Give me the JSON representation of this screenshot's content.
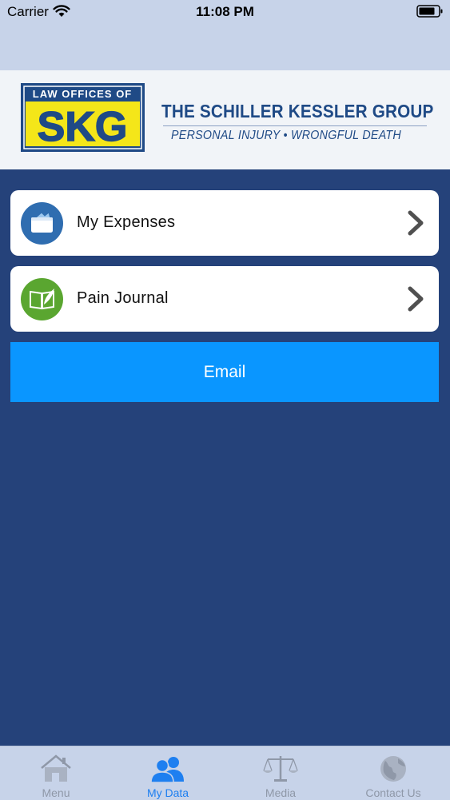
{
  "status_bar": {
    "carrier": "Carrier",
    "time": "11:08 PM"
  },
  "banner": {
    "logo_top": "LAW OFFICES OF",
    "logo_main": "SKG",
    "firm_name": "THE SCHILLER KESSLER GROUP",
    "tagline": "PERSONAL INJURY • WRONGFUL DEATH"
  },
  "menu": {
    "items": [
      {
        "label": "My Expenses",
        "icon": "wallet-icon"
      },
      {
        "label": "Pain Journal",
        "icon": "journal-icon"
      }
    ]
  },
  "email_button": {
    "label": "Email"
  },
  "tabs": [
    {
      "label": "Menu",
      "icon": "home-icon",
      "active": false
    },
    {
      "label": "My Data",
      "icon": "users-icon",
      "active": true
    },
    {
      "label": "Media",
      "icon": "scales-icon",
      "active": false
    },
    {
      "label": "Contact Us",
      "icon": "globe-icon",
      "active": false
    }
  ],
  "colors": {
    "background": "#25427a",
    "bars": "#c7d3e9",
    "email_button": "#0a96ff",
    "active_tab": "#1e7ff0",
    "brand_blue": "#1f4a86",
    "brand_yellow": "#f4e619"
  }
}
